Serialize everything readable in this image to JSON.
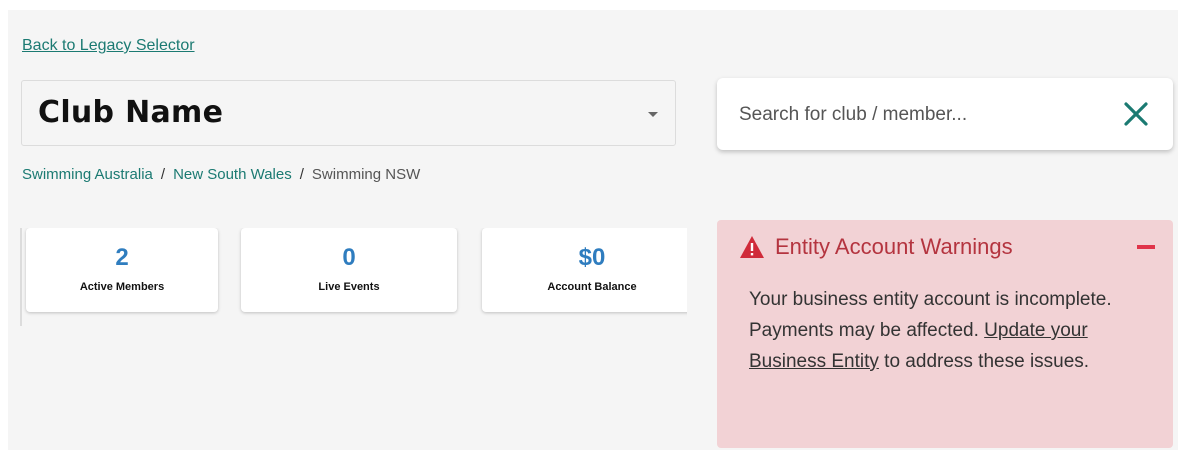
{
  "back_link": "Back to Legacy Selector",
  "club_select": {
    "value": "Club Name"
  },
  "search": {
    "placeholder": "Search for club / member...",
    "close_icon": "close-x-icon",
    "accent": "#1b7a72"
  },
  "breadcrumb": {
    "items": [
      "Swimming Australia",
      "New South Wales",
      "Swimming NSW"
    ],
    "separator": "/"
  },
  "stats": [
    {
      "value": "2",
      "label": "Active Members"
    },
    {
      "value": "0",
      "label": "Live Events"
    },
    {
      "value": "$0",
      "label": "Account Balance"
    }
  ],
  "warning": {
    "icon": "warning-triangle-icon",
    "title": "Entity Account Warnings",
    "body_before": "Your business entity account is incomplete. Payments may be affected. ",
    "link_text": "Update your Business Entity",
    "body_after": " to address these issues.",
    "bg_color": "#f2d2d5",
    "title_color": "#b4343f"
  },
  "colors": {
    "link": "#1b7a72",
    "stat_value": "#2f7dbf"
  }
}
